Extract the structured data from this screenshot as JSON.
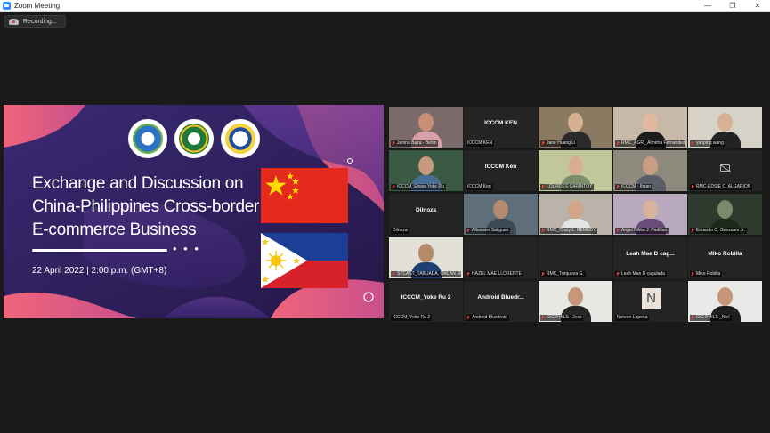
{
  "window": {
    "title": "Zoom Meeting",
    "controls": [
      "—",
      "❐",
      "✕"
    ]
  },
  "recording": {
    "label": "Recording..."
  },
  "slide": {
    "title_lines": [
      "Exchange and Discussion on",
      "China-Philippines Cross-border",
      "E-commerce Business"
    ],
    "dots": "• • •",
    "date": "22 April 2022 | 2:00 p.m. (GMT+8)"
  },
  "participants": [
    {
      "name": "Janina Baza - Betlin",
      "type": "video",
      "bg": "#7a6a6a",
      "skin": "#c98f76",
      "shirt": "#d8a0a8",
      "muted": true
    },
    {
      "name": "ICCCM KEN",
      "type": "name",
      "center": "ICCCM KEN",
      "muted": false
    },
    {
      "name": "Jane Huang Li",
      "type": "video",
      "bg": "#8a7a62",
      "skin": "#d6b08f",
      "shirt": "#2a2a2a",
      "muted": true
    },
    {
      "name": "RMC_AGRI_Almirha Fernandez",
      "type": "video",
      "bg": "#c7b9a8",
      "skin": "#e0b9a0",
      "shirt": "#1c1c1c",
      "muted": true
    },
    {
      "name": "yanping wang",
      "type": "video",
      "bg": "#d6d2c8",
      "skin": "#d7b193",
      "shirt": "#222222",
      "muted": true
    },
    {
      "name": "ICCCM_Eloisa Yoke Ru",
      "type": "video",
      "bg": "#3b5a43",
      "skin": "#c79a7d",
      "shirt": "#4a6f96",
      "muted": true,
      "active": true
    },
    {
      "name": "ICCCM Ken",
      "type": "name",
      "center": "ICCCM Ken",
      "muted": false
    },
    {
      "name": "LOURDES CARINTOY",
      "type": "video",
      "bg": "#c2c79a",
      "skin": "#d8ad92",
      "shirt": "#7b8f6a",
      "muted": true
    },
    {
      "name": "ICCCM - Ihsan",
      "type": "video",
      "bg": "#8f8a7e",
      "skin": "#c99e82",
      "shirt": "#5a5f6a",
      "muted": true
    },
    {
      "name": "RMC-EDSIE C. ALGARION",
      "type": "camoff",
      "muted": true
    },
    {
      "name": "Dilnoza",
      "type": "name",
      "center": "Dilnoza",
      "muted": false
    },
    {
      "name": "Albassier Saliguan",
      "type": "video",
      "bg": "#5e6e7a",
      "skin": "#b58a6e",
      "shirt": "#3d4a55",
      "muted": true
    },
    {
      "name": "RMC_Cristy L. REMEDY",
      "type": "video",
      "bg": "#b9b3aa",
      "skin": "#d2a68a",
      "shirt": "#e5e5e5",
      "muted": true
    },
    {
      "name": "Angel Nikka J. Padillas",
      "type": "video",
      "bg": "#b8a9bf",
      "skin": "#d8b29b",
      "shirt": "#6a4c7a",
      "muted": true
    },
    {
      "name": "Eduardo O. Gonzales Jr.",
      "type": "video",
      "bg": "#2d3a2d",
      "skin": "#7a8a6a",
      "shirt": "#1c2a1c",
      "muted": true
    },
    {
      "name": "STCAST_TABUADA, ORLAN JR",
      "type": "video",
      "bg": "#e3e0d8",
      "skin": "#b6896b",
      "shirt": "#1e3f74",
      "muted": true
    },
    {
      "name": "HAZEL MAE LLORENTE",
      "type": "blank",
      "muted": true
    },
    {
      "name": "RMC_Turqueza G.",
      "type": "blank",
      "muted": true
    },
    {
      "name": "Leah Mae D cagulada",
      "type": "name",
      "center": "Leah Mae D cag...",
      "muted": true
    },
    {
      "name": "Miko Robilla",
      "type": "name",
      "center": "Miko Robilla",
      "muted": true
    },
    {
      "name": "ICCCM_Yoke Ru 2",
      "type": "name",
      "center": "ICCCM_Yoke Ru 2",
      "muted": false
    },
    {
      "name": "Android Bluedroid",
      "type": "name",
      "center": "Android  Bluedr...",
      "muted": true
    },
    {
      "name": "GIC PHILS - Jess",
      "type": "video",
      "bg": "#e7e7e4",
      "skin": "#c6977b",
      "shirt": "#262626",
      "muted": true
    },
    {
      "name": "Noreen Lopena",
      "type": "letter",
      "letter": "N",
      "muted": false
    },
    {
      "name": "GIC PHILS _Niel",
      "type": "video",
      "bg": "#e9e9e7",
      "skin": "#c69679",
      "shirt": "#1e1e1e",
      "muted": true
    }
  ],
  "colors": {
    "meeting_bg": "#1a1a1a",
    "tile_bg": "#242424",
    "active_speaker": "#9ccc3c",
    "mute_red": "#e34040",
    "slide_bg": "#2c1d52"
  }
}
